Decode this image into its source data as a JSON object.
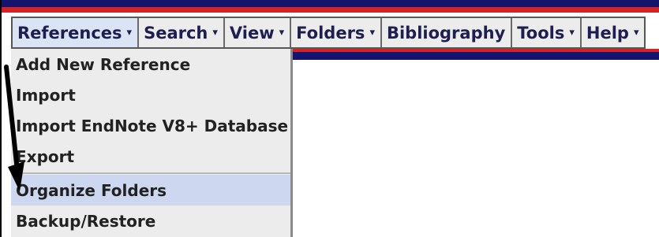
{
  "menubar": {
    "items": [
      {
        "label": "References",
        "caret": "▾",
        "active": true
      },
      {
        "label": "Search",
        "caret": "▾"
      },
      {
        "label": "View",
        "caret": "▾"
      },
      {
        "label": "Folders",
        "caret": "▾"
      },
      {
        "label": "Bibliography",
        "caret": ""
      },
      {
        "label": "Tools",
        "caret": "▾"
      },
      {
        "label": "Help",
        "caret": "▾"
      }
    ]
  },
  "dropdown": {
    "items": [
      {
        "label": "Add New Reference"
      },
      {
        "label": "Import"
      },
      {
        "label": "Import EndNote V8+ Database"
      },
      {
        "label": "Export"
      },
      {
        "label": "Organize Folders",
        "highlighted": true
      },
      {
        "label": "Backup/Restore"
      }
    ]
  },
  "colors": {
    "stripe_navy": "#14146e",
    "stripe_red": "#d52222",
    "menu_text": "#1e1e50",
    "highlight": "#cdd7ef"
  }
}
